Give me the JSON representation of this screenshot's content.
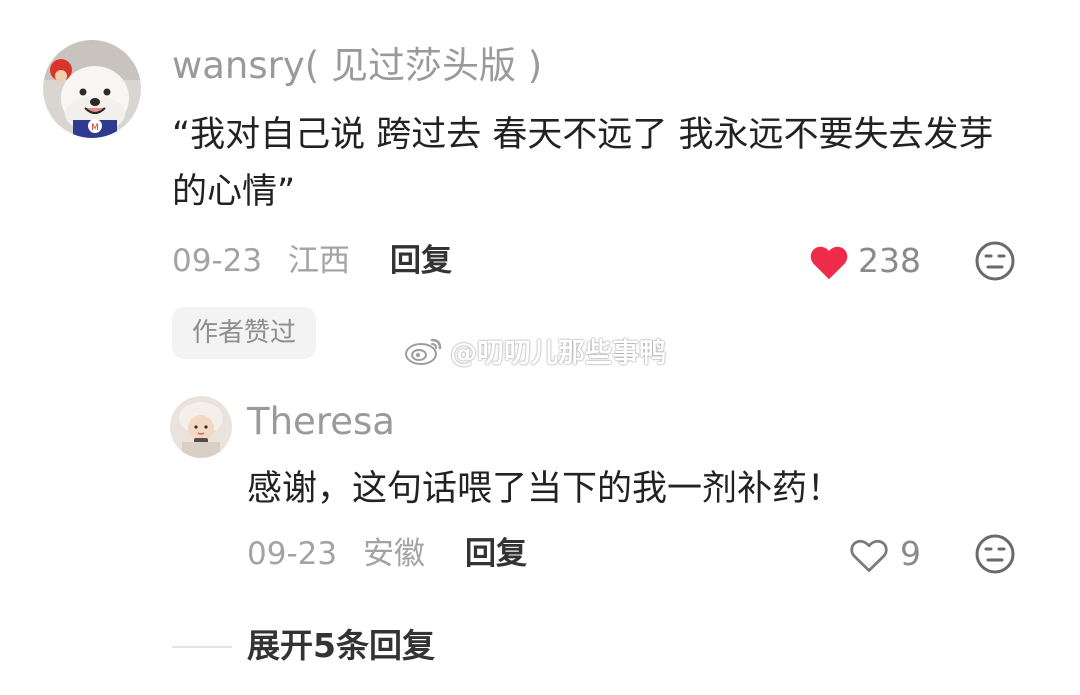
{
  "comment": {
    "username": "wansry( 见过莎头版 )",
    "text": "“我对自己说 跨过去 春天不远了 我永远不要失去发芽的心情”",
    "date": "09-23",
    "location": "江西",
    "reply_label": "回复",
    "like_count": "238",
    "liked": true,
    "author_liked_badge": "作者赞过"
  },
  "reply": {
    "username": "Theresa",
    "text": "感谢，这句话喂了当下的我一剂补药！",
    "date": "09-23",
    "location": "安徽",
    "reply_label": "回复",
    "like_count": "9",
    "liked": false
  },
  "expand_replies_label": "展开5条回复",
  "watermark": "@叨叨儿那些事鸭",
  "colors": {
    "like_active": "#ee2c4a",
    "meta_gray": "#a3a3a3",
    "username_gray": "#9a9a9a"
  },
  "icons": {
    "like_active": "heart-filled-icon",
    "like_inactive": "heart-outline-icon",
    "dislike": "meh-face-icon",
    "watermark_logo": "weibo-logo-icon"
  }
}
